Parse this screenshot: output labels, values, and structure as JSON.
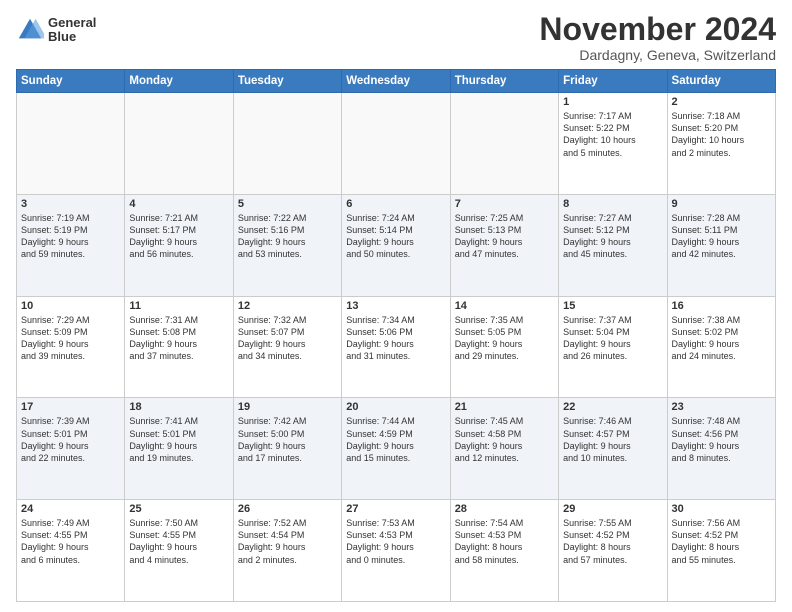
{
  "logo": {
    "line1": "General",
    "line2": "Blue"
  },
  "title": "November 2024",
  "location": "Dardagny, Geneva, Switzerland",
  "weekdays": [
    "Sunday",
    "Monday",
    "Tuesday",
    "Wednesday",
    "Thursday",
    "Friday",
    "Saturday"
  ],
  "weeks": [
    [
      {
        "day": "",
        "info": ""
      },
      {
        "day": "",
        "info": ""
      },
      {
        "day": "",
        "info": ""
      },
      {
        "day": "",
        "info": ""
      },
      {
        "day": "",
        "info": ""
      },
      {
        "day": "1",
        "info": "Sunrise: 7:17 AM\nSunset: 5:22 PM\nDaylight: 10 hours\nand 5 minutes."
      },
      {
        "day": "2",
        "info": "Sunrise: 7:18 AM\nSunset: 5:20 PM\nDaylight: 10 hours\nand 2 minutes."
      }
    ],
    [
      {
        "day": "3",
        "info": "Sunrise: 7:19 AM\nSunset: 5:19 PM\nDaylight: 9 hours\nand 59 minutes."
      },
      {
        "day": "4",
        "info": "Sunrise: 7:21 AM\nSunset: 5:17 PM\nDaylight: 9 hours\nand 56 minutes."
      },
      {
        "day": "5",
        "info": "Sunrise: 7:22 AM\nSunset: 5:16 PM\nDaylight: 9 hours\nand 53 minutes."
      },
      {
        "day": "6",
        "info": "Sunrise: 7:24 AM\nSunset: 5:14 PM\nDaylight: 9 hours\nand 50 minutes."
      },
      {
        "day": "7",
        "info": "Sunrise: 7:25 AM\nSunset: 5:13 PM\nDaylight: 9 hours\nand 47 minutes."
      },
      {
        "day": "8",
        "info": "Sunrise: 7:27 AM\nSunset: 5:12 PM\nDaylight: 9 hours\nand 45 minutes."
      },
      {
        "day": "9",
        "info": "Sunrise: 7:28 AM\nSunset: 5:11 PM\nDaylight: 9 hours\nand 42 minutes."
      }
    ],
    [
      {
        "day": "10",
        "info": "Sunrise: 7:29 AM\nSunset: 5:09 PM\nDaylight: 9 hours\nand 39 minutes."
      },
      {
        "day": "11",
        "info": "Sunrise: 7:31 AM\nSunset: 5:08 PM\nDaylight: 9 hours\nand 37 minutes."
      },
      {
        "day": "12",
        "info": "Sunrise: 7:32 AM\nSunset: 5:07 PM\nDaylight: 9 hours\nand 34 minutes."
      },
      {
        "day": "13",
        "info": "Sunrise: 7:34 AM\nSunset: 5:06 PM\nDaylight: 9 hours\nand 31 minutes."
      },
      {
        "day": "14",
        "info": "Sunrise: 7:35 AM\nSunset: 5:05 PM\nDaylight: 9 hours\nand 29 minutes."
      },
      {
        "day": "15",
        "info": "Sunrise: 7:37 AM\nSunset: 5:04 PM\nDaylight: 9 hours\nand 26 minutes."
      },
      {
        "day": "16",
        "info": "Sunrise: 7:38 AM\nSunset: 5:02 PM\nDaylight: 9 hours\nand 24 minutes."
      }
    ],
    [
      {
        "day": "17",
        "info": "Sunrise: 7:39 AM\nSunset: 5:01 PM\nDaylight: 9 hours\nand 22 minutes."
      },
      {
        "day": "18",
        "info": "Sunrise: 7:41 AM\nSunset: 5:01 PM\nDaylight: 9 hours\nand 19 minutes."
      },
      {
        "day": "19",
        "info": "Sunrise: 7:42 AM\nSunset: 5:00 PM\nDaylight: 9 hours\nand 17 minutes."
      },
      {
        "day": "20",
        "info": "Sunrise: 7:44 AM\nSunset: 4:59 PM\nDaylight: 9 hours\nand 15 minutes."
      },
      {
        "day": "21",
        "info": "Sunrise: 7:45 AM\nSunset: 4:58 PM\nDaylight: 9 hours\nand 12 minutes."
      },
      {
        "day": "22",
        "info": "Sunrise: 7:46 AM\nSunset: 4:57 PM\nDaylight: 9 hours\nand 10 minutes."
      },
      {
        "day": "23",
        "info": "Sunrise: 7:48 AM\nSunset: 4:56 PM\nDaylight: 9 hours\nand 8 minutes."
      }
    ],
    [
      {
        "day": "24",
        "info": "Sunrise: 7:49 AM\nSunset: 4:55 PM\nDaylight: 9 hours\nand 6 minutes."
      },
      {
        "day": "25",
        "info": "Sunrise: 7:50 AM\nSunset: 4:55 PM\nDaylight: 9 hours\nand 4 minutes."
      },
      {
        "day": "26",
        "info": "Sunrise: 7:52 AM\nSunset: 4:54 PM\nDaylight: 9 hours\nand 2 minutes."
      },
      {
        "day": "27",
        "info": "Sunrise: 7:53 AM\nSunset: 4:53 PM\nDaylight: 9 hours\nand 0 minutes."
      },
      {
        "day": "28",
        "info": "Sunrise: 7:54 AM\nSunset: 4:53 PM\nDaylight: 8 hours\nand 58 minutes."
      },
      {
        "day": "29",
        "info": "Sunrise: 7:55 AM\nSunset: 4:52 PM\nDaylight: 8 hours\nand 57 minutes."
      },
      {
        "day": "30",
        "info": "Sunrise: 7:56 AM\nSunset: 4:52 PM\nDaylight: 8 hours\nand 55 minutes."
      }
    ]
  ]
}
